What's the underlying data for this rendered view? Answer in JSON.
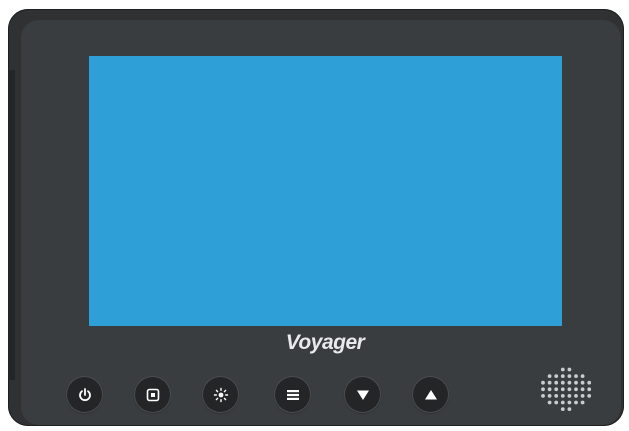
{
  "brand": {
    "name": "Voyager"
  },
  "buttons": [
    {
      "id": "power",
      "icon": "power-icon"
    },
    {
      "id": "source",
      "icon": "square-dot-icon"
    },
    {
      "id": "brightness",
      "icon": "sun-icon"
    },
    {
      "id": "menu",
      "icon": "menu-icon"
    },
    {
      "id": "down",
      "icon": "triangle-down-icon"
    },
    {
      "id": "up",
      "icon": "triangle-up-icon"
    }
  ],
  "colors": {
    "screen": "#2f9fd8",
    "bezel": "#3a3d3f",
    "button": "#232526",
    "icon": "#ffffff"
  }
}
